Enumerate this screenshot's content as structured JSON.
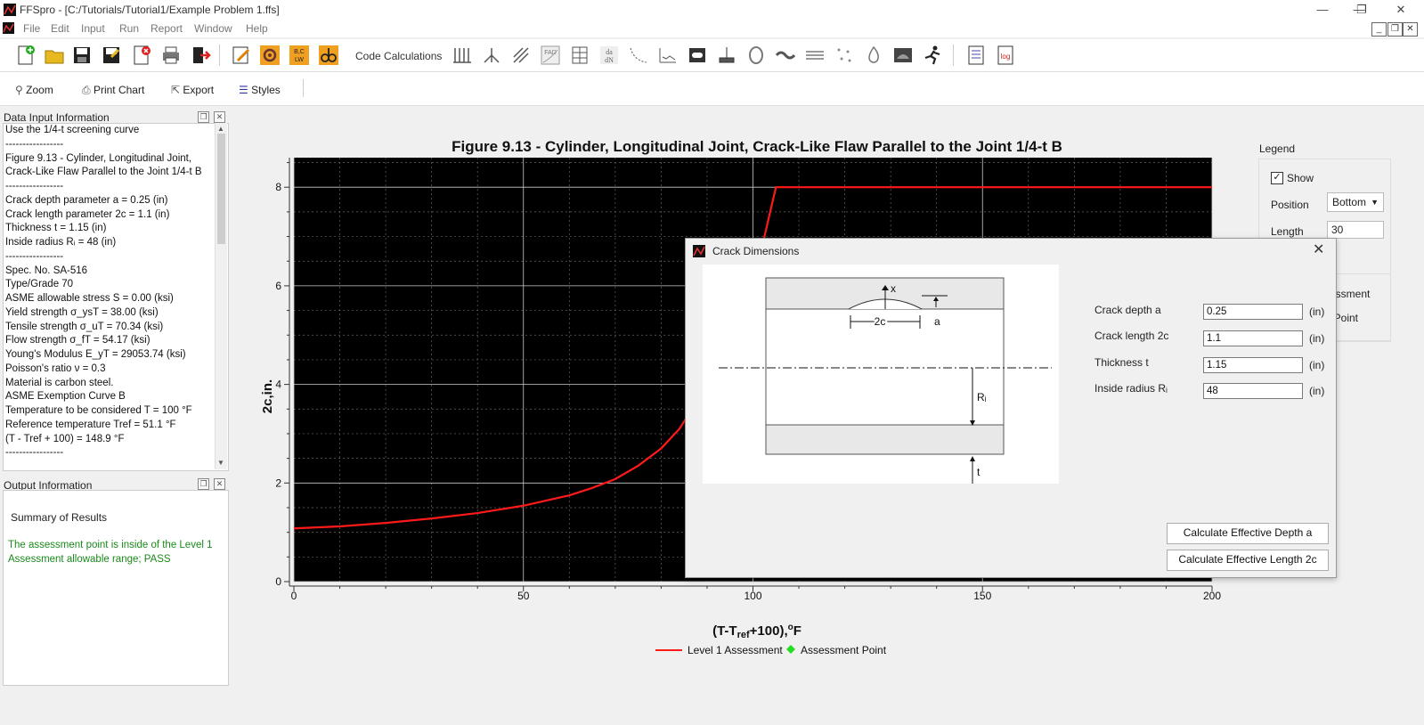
{
  "window": {
    "title": "FFSpro - [C:/Tutorials/Tutorial1/Example Problem 1.ffs]"
  },
  "menu": [
    "File",
    "Edit",
    "Input",
    "Run",
    "Report",
    "Window",
    "Help"
  ],
  "toolbar": {
    "code_calculations": "Code Calculations"
  },
  "chart_toolbar": {
    "zoom": "Zoom",
    "print": "Print Chart",
    "export": "Export",
    "styles": "Styles"
  },
  "data_panel": {
    "title": "Data Input Information",
    "lines": [
      "Use the 1/4-t screening curve",
      "-----------------",
      "Figure 9.13 - Cylinder, Longitudinal Joint,",
      "Crack-Like Flaw Parallel to the Joint 1/4-t B",
      "-----------------",
      "Crack depth parameter a = 0.25 (in)",
      "Crack length parameter 2c = 1.1 (in)",
      "Thickness t = 1.15 (in)",
      "Inside radius Rᵢ = 48 (in)",
      "-----------------",
      "Spec. No. SA-516",
      "Type/Grade 70",
      "ASME allowable stress S = 0.00 (ksi)",
      "Yield strength σ_ysT = 38.00 (ksi)",
      "Tensile strength σ_uT = 70.34 (ksi)",
      "Flow strength σ_fT = 54.17 (ksi)",
      "Young's Modulus E_yT = 29053.74 (ksi)",
      "Poisson's ratio ν = 0.3",
      "Material is carbon steel.",
      "ASME Exemption Curve B",
      "Temperature to be considered T = 100 °F",
      "Reference temperature Tref = 51.1 °F",
      "(T - Tref + 100) = 148.9 °F",
      "-----------------"
    ]
  },
  "output_panel": {
    "title": "Output Information",
    "summary": "Summary of Results",
    "result_line1": "The assessment point is inside of the Level 1",
    "result_line2": "Assessment allowable range; PASS",
    "result_color": "#1a8a1a"
  },
  "legend_panel": {
    "title": "Legend",
    "show_label": "Show",
    "show_checked": true,
    "position_label": "Position",
    "position_value": "Bottom",
    "length_label": "Length",
    "length_value": "30",
    "partial1": "sessment",
    "partial2": "t Point"
  },
  "chart_data": {
    "type": "line",
    "title": "Figure 9.13 - Cylinder, Longitudinal Joint, Crack-Like Flaw Parallel to the Joint 1/4-t B",
    "xlabel": "(T-T_ref+100),°F",
    "ylabel": "2c,in.",
    "xlim": [
      0,
      200
    ],
    "ylim": [
      0,
      8.6
    ],
    "xticks": [
      0,
      50,
      100,
      150,
      200
    ],
    "yticks": [
      0,
      2,
      4,
      6,
      8
    ],
    "grid": true,
    "background": "#000000",
    "legend_position": "bottom",
    "series": [
      {
        "name": "Level 1 Assessment",
        "color": "#ff1a1a",
        "x": [
          0,
          10,
          20,
          30,
          40,
          50,
          60,
          65,
          70,
          75,
          80,
          84,
          90,
          95,
          100,
          105,
          110,
          150,
          200
        ],
        "y": [
          1.08,
          1.12,
          1.19,
          1.28,
          1.39,
          1.54,
          1.75,
          1.9,
          2.08,
          2.35,
          2.7,
          3.1,
          4.0,
          5.0,
          6.0,
          8.0,
          8.0,
          8.0,
          8.0
        ]
      },
      {
        "name": "Assessment Point",
        "color": "#22dd22",
        "marker": "diamond",
        "x": [],
        "y": []
      }
    ]
  },
  "dialog": {
    "title": "Crack Dimensions",
    "fields": [
      {
        "label": "Crack depth a",
        "value": "0.25",
        "unit": "(in)"
      },
      {
        "label": "Crack length 2c",
        "value": "1.1",
        "unit": "(in)"
      },
      {
        "label": "Thickness t",
        "value": "1.15",
        "unit": "(in)"
      },
      {
        "label": "Inside radius Rᵢ",
        "value": "48",
        "unit": "(in)"
      }
    ],
    "btn_depth": "Calculate Effective Depth a",
    "btn_length": "Calculate Effective Length 2c",
    "diagram": {
      "x": "x",
      "two_c": "2c",
      "a": "a",
      "ri": "Rᵢ",
      "t": "t"
    }
  }
}
